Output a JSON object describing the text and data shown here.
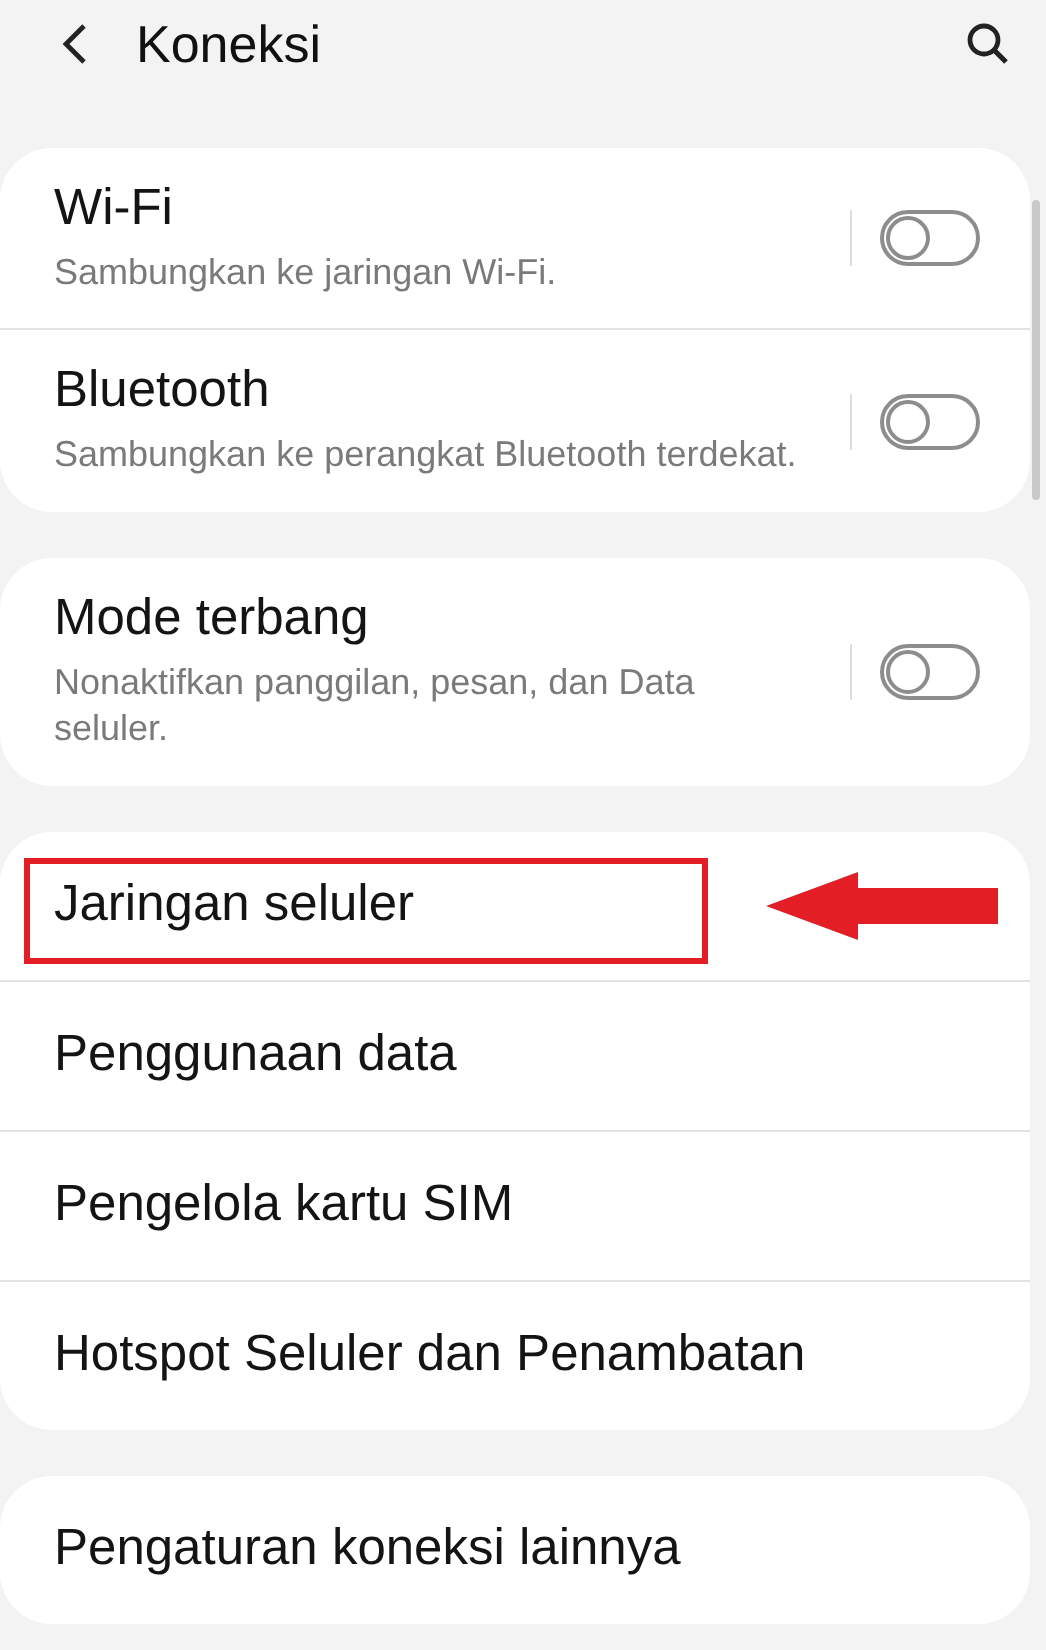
{
  "header": {
    "title": "Koneksi"
  },
  "groups": [
    {
      "items": [
        {
          "kind": "toggle",
          "title": "Wi-Fi",
          "subtitle": "Sambungkan ke jaringan Wi-Fi.",
          "on": false
        },
        {
          "kind": "toggle",
          "title": "Bluetooth",
          "subtitle": "Sambungkan ke perangkat Bluetooth terdekat.",
          "on": false
        }
      ]
    },
    {
      "items": [
        {
          "kind": "toggle",
          "title": "Mode terbang",
          "subtitle": "Nonaktifkan panggilan, pesan, dan Data\nseluler.",
          "on": false
        }
      ]
    },
    {
      "items": [
        {
          "kind": "link",
          "title": "Jaringan seluler",
          "highlighted": true
        },
        {
          "kind": "link",
          "title": "Penggunaan data",
          "highlighted": false
        },
        {
          "kind": "link",
          "title": "Pengelola kartu SIM",
          "highlighted": false
        },
        {
          "kind": "link",
          "title": "Hotspot Seluler dan Penambatan",
          "highlighted": false
        }
      ]
    },
    {
      "items": [
        {
          "kind": "link",
          "title": "Pengaturan koneksi lainnya",
          "highlighted": false
        }
      ]
    }
  ]
}
